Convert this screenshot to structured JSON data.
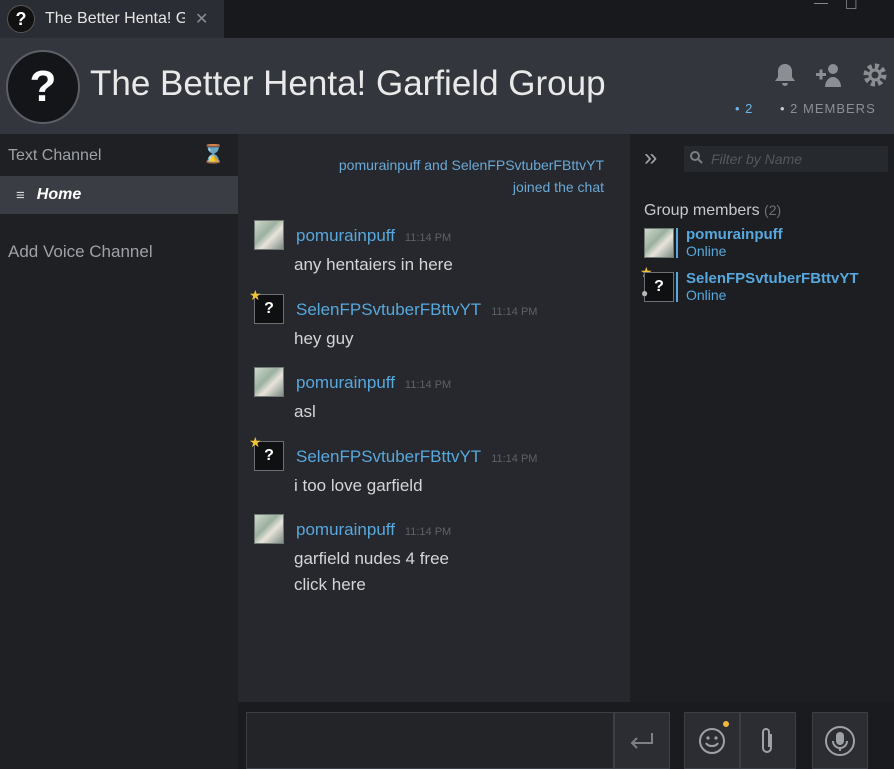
{
  "tab": {
    "title": "The Better Henta! Garfield Group",
    "close": "✕"
  },
  "window": {
    "minimize": "—",
    "maximize": "☐"
  },
  "header": {
    "avatar": "?",
    "title": "The Better Henta! Garfield Group",
    "online_count": "2",
    "members_label": "2 MEMBERS"
  },
  "sidebar": {
    "text_channel": "Text Channel",
    "home": "Home",
    "add_voice": "Add Voice Channel"
  },
  "chat": {
    "joined_line1": "pomurainpuff and SelenFPSvtuberFBttvYT",
    "joined_line2": "joined the chat",
    "messages": [
      {
        "author": "pomurainpuff",
        "time": "11:14 PM",
        "text": "any hentaiers in here",
        "text2": ""
      },
      {
        "author": "SelenFPSvtuberFBttvYT",
        "time": "11:14 PM",
        "text": "hey guy",
        "text2": ""
      },
      {
        "author": "pomurainpuff",
        "time": "11:14 PM",
        "text": "asl",
        "text2": ""
      },
      {
        "author": "SelenFPSvtuberFBttvYT",
        "time": "11:14 PM",
        "text": "i too love garfield",
        "text2": ""
      },
      {
        "author": "pomurainpuff",
        "time": "11:14 PM",
        "text": "garfield nudes 4 free",
        "text2": "click here"
      }
    ]
  },
  "members_panel": {
    "filter_placeholder": "Filter by Name",
    "group_members_label": "Group members",
    "group_members_count": "(2)",
    "members": [
      {
        "name": "pomurainpuff",
        "status": "Online"
      },
      {
        "name": "SelenFPSvtuberFBttvYT",
        "status": "Online"
      }
    ]
  },
  "colors": {
    "accent": "#57a8dd",
    "star": "#f1c232",
    "header_bg": "#33363c"
  },
  "icons": [
    "question-avatar-icon",
    "bell-icon",
    "add-friend-icon",
    "gear-icon",
    "hourglass-icon",
    "list-icon",
    "chevron-double-right-icon",
    "search-icon",
    "enter-icon",
    "emoji-icon",
    "paperclip-icon",
    "microphone-icon",
    "star-icon"
  ]
}
